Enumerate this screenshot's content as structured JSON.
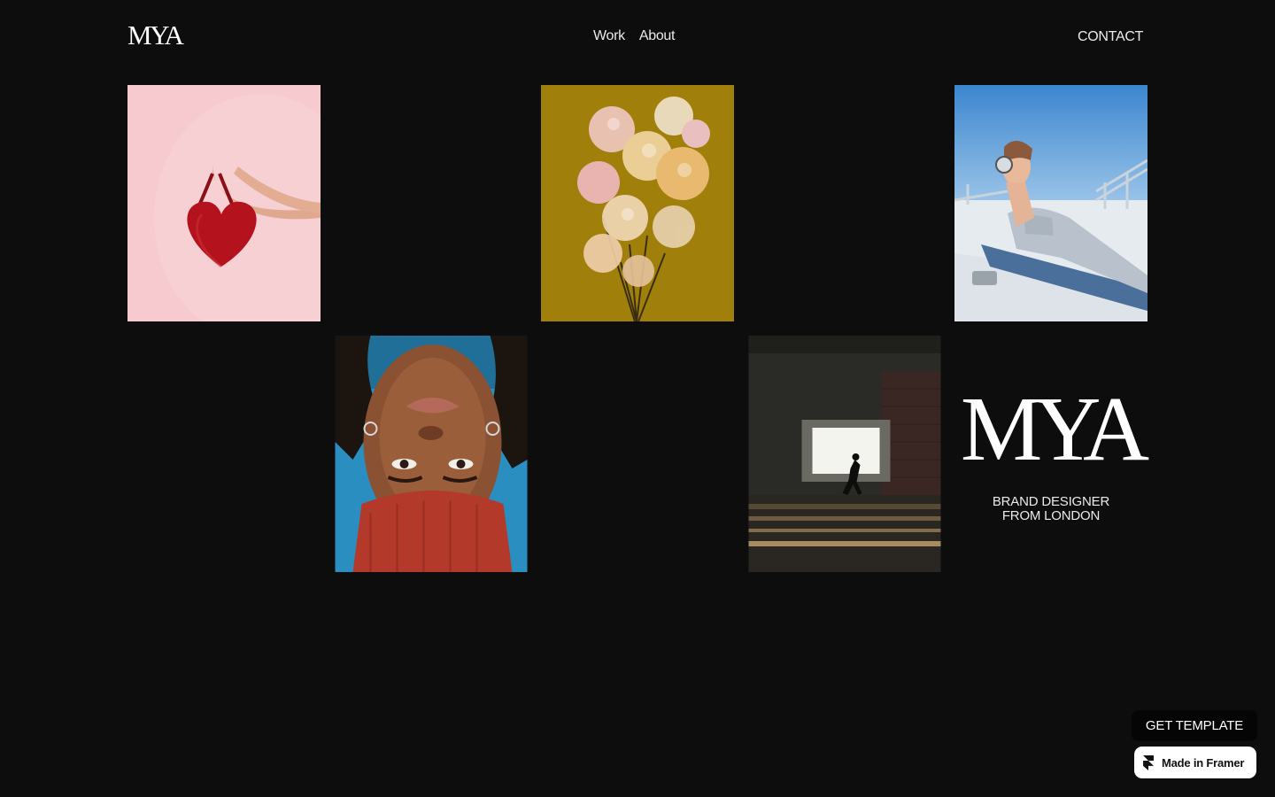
{
  "header": {
    "logo": "MYA",
    "nav": [
      {
        "label": "Work"
      },
      {
        "label": "About"
      }
    ],
    "contact": "CONTACT"
  },
  "gallery": [
    {
      "name": "heart-bag-photo",
      "bg": "#f7cbd0"
    },
    {
      "name": "glass-flowers-photo",
      "bg": "#a0800a"
    },
    {
      "name": "rooftop-headphones-photo",
      "bg": "#5d9bd6"
    },
    {
      "name": "upside-down-portrait-photo",
      "bg": "#2a8ec0"
    },
    {
      "name": "night-runner-photo",
      "bg": "#1a1a18"
    }
  ],
  "brand": {
    "logo": "MYA",
    "tagline_line1": "BRAND DESIGNER",
    "tagline_line2": "FROM LONDON"
  },
  "cta": {
    "get_template": "GET TEMPLATE",
    "made_in_framer": "Made in Framer"
  },
  "colors": {
    "background": "#0d0d0d",
    "text": "#ffffff"
  }
}
